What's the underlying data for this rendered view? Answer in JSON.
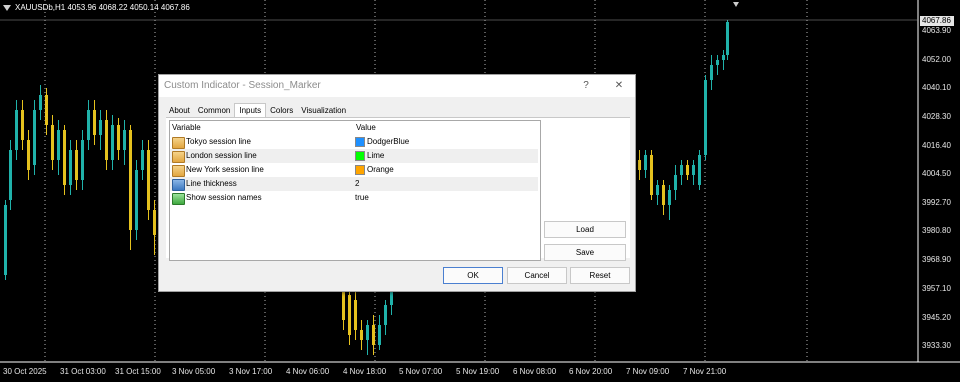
{
  "chart": {
    "symbol_info": "XAUUSDb,H1  4053.96 4068.22 4050.14 4067.86",
    "current_price": "4067.86",
    "price_labels": [
      "4063.90",
      "4052.00",
      "4040.10",
      "4028.30",
      "4016.40",
      "4004.50",
      "3992.70",
      "3980.80",
      "3968.90",
      "3957.10",
      "3945.20",
      "3933.30"
    ],
    "time_labels": [
      "30 Oct 2025",
      "31 Oct 03:00",
      "31 Oct 15:00",
      "3 Nov 05:00",
      "3 Nov 17:00",
      "4 Nov 06:00",
      "4 Nov 18:00",
      "5 Nov 07:00",
      "5 Nov 19:00",
      "6 Nov 08:00",
      "6 Nov 20:00",
      "7 Nov 09:00",
      "7 Nov 21:00"
    ],
    "colors": {
      "bull": "#20b2aa",
      "bear": "#e6c21e",
      "grid": "#ffffff",
      "background": "#000000"
    }
  },
  "dialog": {
    "title": "Custom Indicator - Session_Marker",
    "help": "?",
    "close": "✕",
    "tabs": [
      "About",
      "Common",
      "Inputs",
      "Colors",
      "Visualization"
    ],
    "active_tab": "Inputs",
    "columns": {
      "variable": "Variable",
      "value": "Value"
    },
    "rows": [
      {
        "variable": "Tokyo session line",
        "value": "DodgerBlue",
        "swatch": "#1e90ff",
        "icon": "color-icon"
      },
      {
        "variable": "London session line",
        "value": "Lime",
        "swatch": "#00ff00",
        "icon": "color-icon"
      },
      {
        "variable": "New York session line",
        "value": "Orange",
        "swatch": "#ffa500",
        "icon": "color-icon"
      },
      {
        "variable": "Line thickness",
        "value": "2",
        "icon": "number-icon"
      },
      {
        "variable": "Show session names",
        "value": "true",
        "icon": "bool-icon"
      }
    ],
    "buttons": {
      "load": "Load",
      "save": "Save",
      "ok": "OK",
      "cancel": "Cancel",
      "reset": "Reset"
    }
  }
}
